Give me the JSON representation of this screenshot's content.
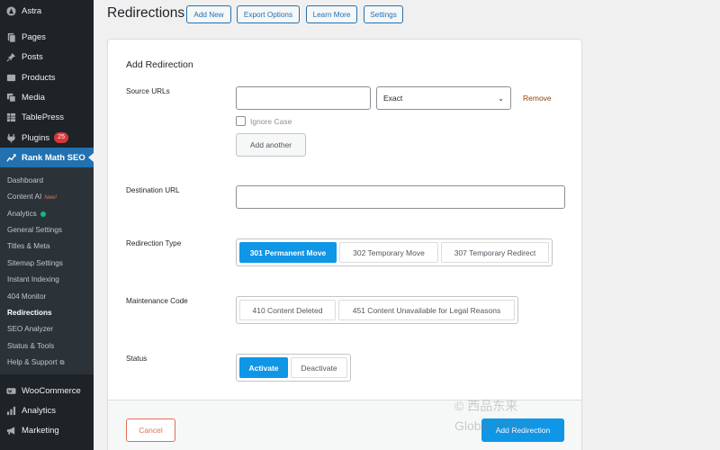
{
  "sidebar": {
    "items": [
      {
        "label": "Astra",
        "icon": "astra-icon"
      },
      {
        "label": "Pages",
        "icon": "pages-icon"
      },
      {
        "label": "Posts",
        "icon": "pin-icon"
      },
      {
        "label": "Products",
        "icon": "products-icon"
      },
      {
        "label": "Media",
        "icon": "media-icon"
      },
      {
        "label": "TablePress",
        "icon": "table-icon"
      },
      {
        "label": "Plugins",
        "icon": "plugin-icon",
        "badge": "25"
      },
      {
        "label": "Rank Math SEO",
        "icon": "rank-math-icon"
      },
      {
        "label": "WooCommerce",
        "icon": "woo-icon"
      },
      {
        "label": "Analytics",
        "icon": "analytics-icon"
      },
      {
        "label": "Marketing",
        "icon": "megaphone-icon"
      }
    ],
    "submenu": [
      {
        "label": "Dashboard"
      },
      {
        "label": "Content AI",
        "tag": "New!"
      },
      {
        "label": "Analytics"
      },
      {
        "label": "General Settings"
      },
      {
        "label": "Titles & Meta"
      },
      {
        "label": "Sitemap Settings"
      },
      {
        "label": "Instant Indexing"
      },
      {
        "label": "404 Monitor"
      },
      {
        "label": "Redirections"
      },
      {
        "label": "SEO Analyzer"
      },
      {
        "label": "Status & Tools"
      },
      {
        "label": "Help & Support"
      }
    ]
  },
  "header": {
    "title": "Redirections",
    "buttons": [
      "Add New",
      "Export Options",
      "Learn More",
      "Settings"
    ]
  },
  "form": {
    "title": "Add Redirection",
    "source_urls_label": "Source URLs",
    "source_url_value": "",
    "match_type": "Exact",
    "remove_label": "Remove",
    "ignore_case_label": "Ignore Case",
    "ignore_case_checked": false,
    "add_another_label": "Add another",
    "destination_label": "Destination URL",
    "destination_value": "",
    "redirection_type_label": "Redirection Type",
    "redirection_types": [
      "301 Permanent Move",
      "302 Temporary Move",
      "307 Temporary Redirect"
    ],
    "redirection_type_selected": "301 Permanent Move",
    "maintenance_label": "Maintenance Code",
    "maintenance_codes": [
      "410 Content Deleted",
      "451 Content Unavailable for Legal Reasons"
    ],
    "status_label": "Status",
    "status_options": [
      "Activate",
      "Deactivate"
    ],
    "status_selected": "Activate",
    "cancel_label": "Cancel",
    "submit_label": "Add Redirection"
  },
  "watermark": {
    "line1": "© 西品东来",
    "line2": "Global Digital"
  },
  "colors": {
    "accent": "#0f96e6",
    "sidebar_bg": "#1d2327",
    "active_menu": "#2271b1",
    "cancel": "#e26f56",
    "badge": "#d63638"
  }
}
